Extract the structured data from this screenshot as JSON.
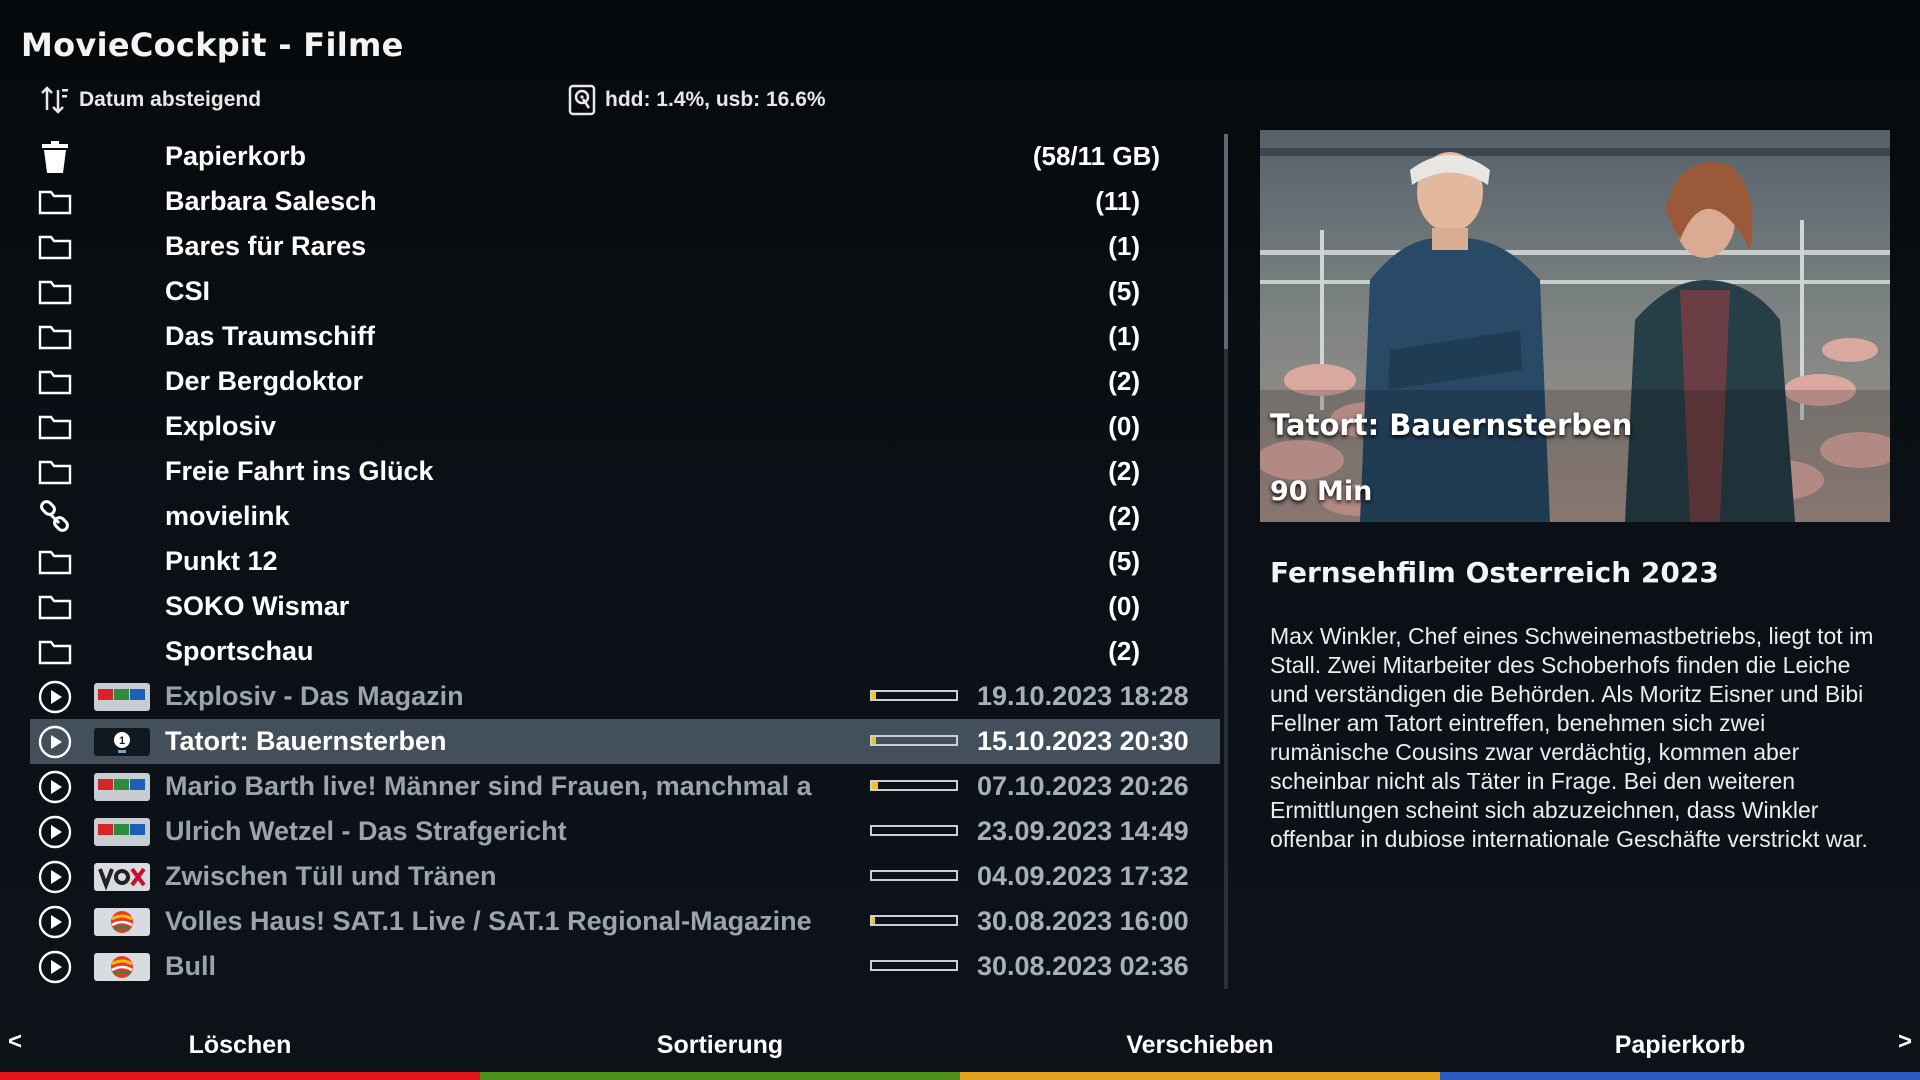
{
  "app": {
    "title": "MovieCockpit - Filme"
  },
  "infobar": {
    "sort_label": "Datum absteigend",
    "sort_icon": "sort-icon",
    "disk_label": "hdd: 1.4%, usb: 16.6%",
    "disk_icon": "harddisk-icon"
  },
  "list": {
    "directories": [
      {
        "name": "Papierkorb",
        "count": "(58/11 GB)",
        "icon": "trash-icon"
      },
      {
        "name": "Barbara Salesch",
        "count": "(11)",
        "icon": "folder-icon"
      },
      {
        "name": "Bares für Rares",
        "count": "(1)",
        "icon": "folder-icon"
      },
      {
        "name": "CSI",
        "count": "(5)",
        "icon": "folder-icon"
      },
      {
        "name": "Das Traumschiff",
        "count": "(1)",
        "icon": "folder-icon"
      },
      {
        "name": "Der Bergdoktor",
        "count": "(2)",
        "icon": "folder-icon"
      },
      {
        "name": "Explosiv",
        "count": "(0)",
        "icon": "folder-icon"
      },
      {
        "name": "Freie Fahrt ins Glück",
        "count": "(2)",
        "icon": "folder-icon"
      },
      {
        "name": "movielink",
        "count": "(2)",
        "icon": "link-icon"
      },
      {
        "name": "Punkt 12",
        "count": "(5)",
        "icon": "folder-icon"
      },
      {
        "name": "SOKO Wismar",
        "count": "(0)",
        "icon": "folder-icon"
      },
      {
        "name": "Sportschau",
        "count": "(2)",
        "icon": "folder-icon"
      }
    ],
    "movies": [
      {
        "name": "Explosiv - Das Magazin",
        "date": "19.10.2023 18:28",
        "progress": 0.05,
        "channel": "RTL",
        "selected": false
      },
      {
        "name": "Tatort: Bauernsterben",
        "date": "15.10.2023 20:30",
        "progress": 0.05,
        "channel": "Das Erste HD",
        "selected": true
      },
      {
        "name": "Mario Barth live! Männer sind Frauen, manchmal a",
        "date": "07.10.2023 20:26",
        "progress": 0.07,
        "channel": "RTL",
        "selected": false
      },
      {
        "name": "Ulrich Wetzel - Das Strafgericht",
        "date": "23.09.2023 14:49",
        "progress": 0,
        "channel": "RTL",
        "selected": false
      },
      {
        "name": "Zwischen Tüll und Tränen",
        "date": "04.09.2023 17:32",
        "progress": 0,
        "channel": "VOX",
        "selected": false
      },
      {
        "name": "Volles Haus! SAT.1 Live / SAT.1 Regional-Magazine",
        "date": "30.08.2023 16:00",
        "progress": 0.04,
        "channel": "SAT.1",
        "selected": false
      },
      {
        "name": "Bull",
        "date": "30.08.2023 02:36",
        "progress": 0,
        "channel": "SAT.1",
        "selected": false
      }
    ]
  },
  "detail": {
    "poster_title": "Tatort: Bauernsterben",
    "poster_length": "90 Min",
    "genre_line": "Fernsehfilm Osterreich 2023",
    "description": "Max Winkler, Chef eines Schweinemastbetriebs, liegt tot im Stall. Zwei Mitarbeiter des Schoberhofs finden die Leiche und verständigen die Behörden. Als Moritz Eisner und Bibi Fellner am Tatort eintreffen, benehmen sich zwei rumänische Cousins zwar verdächtig, kommen aber scheinbar nicht als Täter in Frage.  Bei den weiteren Ermittlungen scheint sich abzuzeichnen, dass Winkler offenbar in dubiose internationale Geschäfte verstrickt war."
  },
  "footer": {
    "prev": "<",
    "next": ">",
    "buttons": [
      {
        "label": "Löschen",
        "color": "#e4161b"
      },
      {
        "label": "Sortierung",
        "color": "#4e8f1c"
      },
      {
        "label": "Verschieben",
        "color": "#e2a21c"
      },
      {
        "label": "Papierkorb",
        "color": "#2c5bc4"
      }
    ]
  },
  "colors": {
    "selection": "#43505c",
    "progress_fill": "#f0c419",
    "dim_text": "#9ca4ab"
  }
}
